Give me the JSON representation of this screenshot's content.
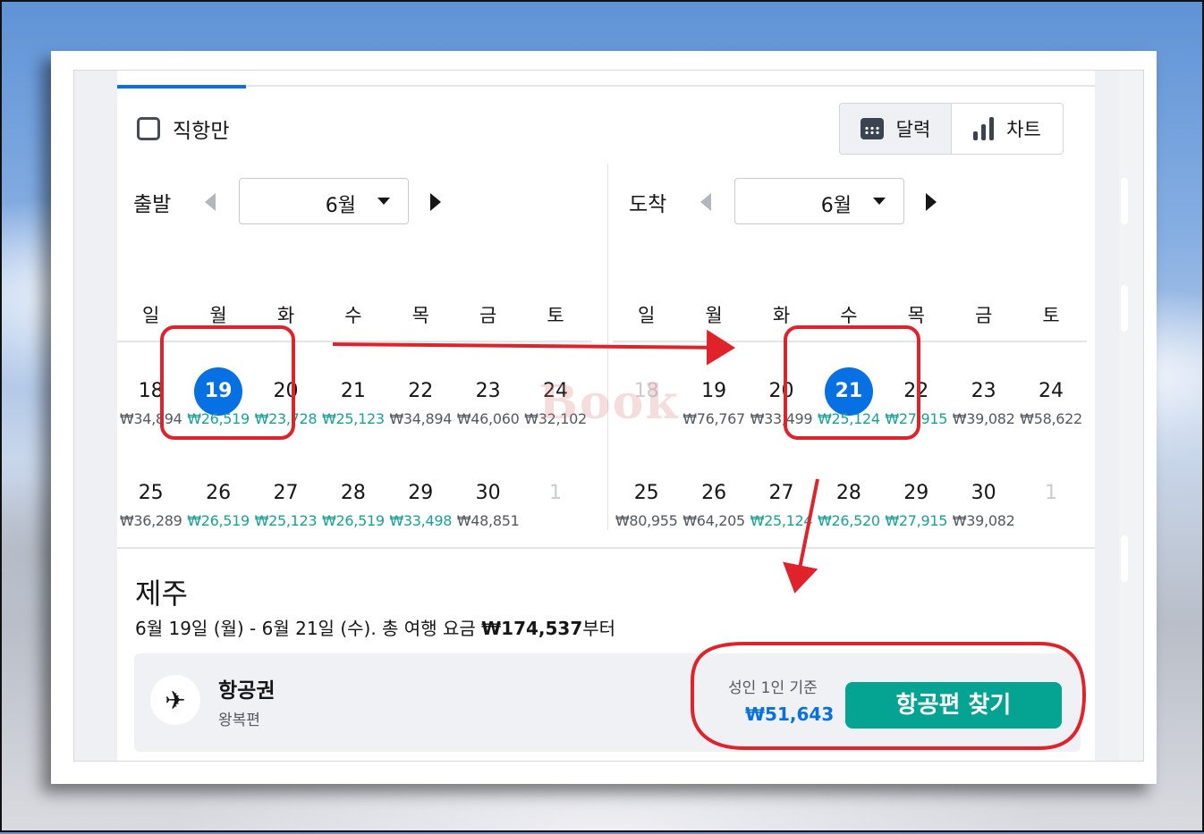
{
  "filters": {
    "direct_only_label": "직항만"
  },
  "view_toggle": {
    "calendar_label": "달력",
    "chart_label": "차트"
  },
  "departure": {
    "title": "출발",
    "month": "6월",
    "weekdays": [
      "일",
      "월",
      "화",
      "수",
      "목",
      "금",
      "토"
    ],
    "weeks": [
      [
        {
          "day": "18",
          "price": "₩34,894",
          "low": false,
          "selected": false,
          "disabled": false
        },
        {
          "day": "19",
          "price": "₩26,519",
          "low": true,
          "selected": true,
          "disabled": false
        },
        {
          "day": "20",
          "price": "₩23,728",
          "low": true,
          "selected": false,
          "disabled": false
        },
        {
          "day": "21",
          "price": "₩25,123",
          "low": true,
          "selected": false,
          "disabled": false
        },
        {
          "day": "22",
          "price": "₩34,894",
          "low": false,
          "selected": false,
          "disabled": false
        },
        {
          "day": "23",
          "price": "₩46,060",
          "low": false,
          "selected": false,
          "disabled": false
        },
        {
          "day": "24",
          "price": "₩32,102",
          "low": false,
          "selected": false,
          "disabled": false
        }
      ],
      [
        {
          "day": "25",
          "price": "₩36,289",
          "low": false,
          "selected": false,
          "disabled": false
        },
        {
          "day": "26",
          "price": "₩26,519",
          "low": true,
          "selected": false,
          "disabled": false
        },
        {
          "day": "27",
          "price": "₩25,123",
          "low": true,
          "selected": false,
          "disabled": false
        },
        {
          "day": "28",
          "price": "₩26,519",
          "low": true,
          "selected": false,
          "disabled": false
        },
        {
          "day": "29",
          "price": "₩33,498",
          "low": true,
          "selected": false,
          "disabled": false
        },
        {
          "day": "30",
          "price": "₩48,851",
          "low": false,
          "selected": false,
          "disabled": false
        },
        {
          "day": "1",
          "price": "",
          "low": false,
          "selected": false,
          "disabled": true
        }
      ]
    ]
  },
  "arrival": {
    "title": "도착",
    "month": "6월",
    "weekdays": [
      "일",
      "월",
      "화",
      "수",
      "목",
      "금",
      "토"
    ],
    "weeks": [
      [
        {
          "day": "18",
          "price": "",
          "low": false,
          "selected": false,
          "disabled": true
        },
        {
          "day": "19",
          "price": "₩76,767",
          "low": false,
          "selected": false,
          "disabled": false
        },
        {
          "day": "20",
          "price": "₩33,499",
          "low": false,
          "selected": false,
          "disabled": false
        },
        {
          "day": "21",
          "price": "₩25,124",
          "low": true,
          "selected": true,
          "disabled": false
        },
        {
          "day": "22",
          "price": "₩27,915",
          "low": true,
          "selected": false,
          "disabled": false
        },
        {
          "day": "23",
          "price": "₩39,082",
          "low": false,
          "selected": false,
          "disabled": false
        },
        {
          "day": "24",
          "price": "₩58,622",
          "low": false,
          "selected": false,
          "disabled": false
        }
      ],
      [
        {
          "day": "25",
          "price": "₩80,955",
          "low": false,
          "selected": false,
          "disabled": false
        },
        {
          "day": "26",
          "price": "₩64,205",
          "low": false,
          "selected": false,
          "disabled": false
        },
        {
          "day": "27",
          "price": "₩25,124",
          "low": true,
          "selected": false,
          "disabled": false
        },
        {
          "day": "28",
          "price": "₩26,520",
          "low": true,
          "selected": false,
          "disabled": false
        },
        {
          "day": "29",
          "price": "₩27,915",
          "low": true,
          "selected": false,
          "disabled": false
        },
        {
          "day": "30",
          "price": "₩39,082",
          "low": false,
          "selected": false,
          "disabled": false
        },
        {
          "day": "1",
          "price": "",
          "low": false,
          "selected": false,
          "disabled": true
        }
      ]
    ]
  },
  "summary": {
    "destination": "제주",
    "dates": "6월 19일 (월) - 6월 21일 (수). 총 여행 요금 ",
    "total": "₩174,537",
    "suffix": "부터"
  },
  "flight": {
    "title": "항공권",
    "subtitle": "왕복편",
    "basis": "성인 1인 기준",
    "price": "₩51,643",
    "button": "항공편 찾기"
  },
  "watermark": "Book",
  "colors": {
    "accent": "#0770e3",
    "low_price": "#17a295",
    "cta": "#05a391",
    "annotation": "#e0222b"
  }
}
